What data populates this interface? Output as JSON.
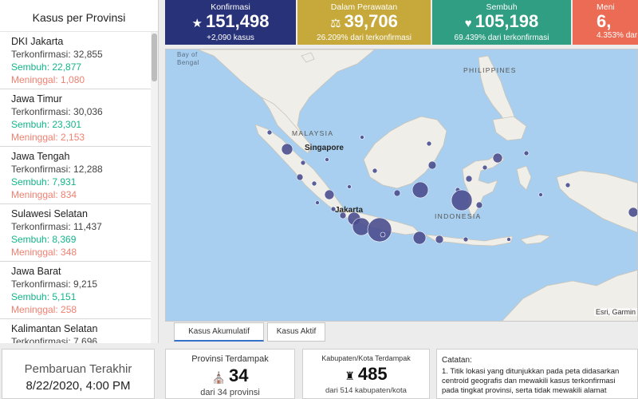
{
  "sidebar": {
    "title": "Kasus per Provinsi",
    "provinces": [
      {
        "name": "DKI Jakarta",
        "confirmed": "Terkonfirmasi: 32,855",
        "recovered": "Sembuh: 22,877",
        "deaths": "Meninggal: 1,080"
      },
      {
        "name": "Jawa Timur",
        "confirmed": "Terkonfirmasi: 30,036",
        "recovered": "Sembuh: 23,301",
        "deaths": "Meninggal: 2,153"
      },
      {
        "name": "Jawa Tengah",
        "confirmed": "Terkonfirmasi: 12,288",
        "recovered": "Sembuh: 7,931",
        "deaths": "Meninggal: 834"
      },
      {
        "name": "Sulawesi Selatan",
        "confirmed": "Terkonfirmasi: 11,437",
        "recovered": "Sembuh: 8,369",
        "deaths": "Meninggal: 348"
      },
      {
        "name": "Jawa Barat",
        "confirmed": "Terkonfirmasi: 9,215",
        "recovered": "Sembuh: 5,151",
        "deaths": "Meninggal: 258"
      },
      {
        "name": "Kalimantan Selatan",
        "confirmed": "Terkonfirmasi: 7,696",
        "recovered": "",
        "deaths": ""
      }
    ]
  },
  "stats": {
    "konfirmasi": {
      "label": "Konfirmasi",
      "value": "151,498",
      "sub": "+2,090 kasus",
      "color": "#283278"
    },
    "perawatan": {
      "label": "Dalam Perawatan",
      "value": "39,706",
      "sub": "26.209% dari terkonfirmasi",
      "color": "#c6a93a"
    },
    "sembuh": {
      "label": "Sembuh",
      "value": "105,198",
      "sub": "69.439% dari terkonfirmasi",
      "color": "#2f9e82"
    },
    "meninggal": {
      "label": "Meni",
      "value": "6,",
      "sub": "4.353% dar",
      "color": "#ec6b55"
    }
  },
  "map": {
    "labels": {
      "bay": "Bay of",
      "bengal": "Bengal",
      "philippines": "PHILIPPINES",
      "malaysia": "MALAYSIA",
      "singapore": "Singapore",
      "jakarta": "Jakarta",
      "indonesia": "INDONESIA"
    },
    "attribution": "Esri, Garmin"
  },
  "tabs": {
    "akumulatif": "Kasus Akumulatif",
    "aktif": "Kasus Aktif"
  },
  "footer": {
    "update_title": "Pembaruan Terakhir",
    "update_time": "8/22/2020, 4:00 PM",
    "prov_title": "Provinsi Terdampak",
    "prov_value": "34",
    "prov_sub": "dari 34 provinsi",
    "kab_title": "Kabupaten/Kota Terdampak",
    "kab_value": "485",
    "kab_sub": "dari 514 kabupaten/kota",
    "notes_title": "Catatan:",
    "notes_line1": "1. Titik lokasi yang ditunjukkan pada peta didasarkan",
    "notes_line2": "centroid geografis dan mewakili kasus terkonfirmasi",
    "notes_line3": "pada tingkat provinsi, serta tidak mewakili alamat"
  },
  "icons": {
    "konfirmasi": "person-icon",
    "perawatan": "hospital-bed-icon",
    "sembuh": "heartbeat-icon",
    "prov": "government-building-icon",
    "kab": "city-icon"
  },
  "colors": {
    "recovered_text": "#12b58a",
    "death_text": "#f08070",
    "bubble": "#4a4e8e",
    "land": "#f0eee8",
    "sea": "#a8cfef"
  }
}
